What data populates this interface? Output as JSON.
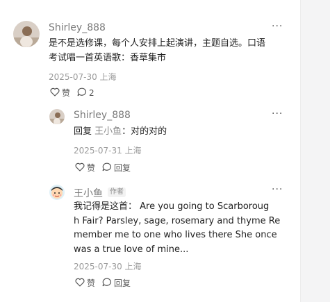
{
  "comments": [
    {
      "name": "Shirley_888",
      "more": "···",
      "lines": [
        "是不是选修课，每个人安排上起演讲，主题自选。口语",
        "考试唱一首英语歌：香草集市"
      ],
      "date": "2025-07-30 上海",
      "like_label": "赞",
      "reply_count": "2"
    }
  ],
  "replies": [
    {
      "name": "Shirley_888",
      "more": "···",
      "reply_prefix": "回复 ",
      "reply_target": "王小鱼",
      "reply_text": "：对的对的",
      "date": "2025-07-31 上海",
      "like_label": "赞",
      "reply_label": "回复"
    },
    {
      "name": "王小鱼",
      "author_tag": "作者",
      "more": "···",
      "lines": [
        "我记得是这首： Are you going to Scarboroug",
        "h Fair? Parsley, sage, rosemary and thyme Re",
        "member me to one who lives there She once",
        "was a true love of mine..."
      ],
      "date": "2025-07-30 上海",
      "like_label": "赞",
      "reply_label": "回复"
    }
  ]
}
